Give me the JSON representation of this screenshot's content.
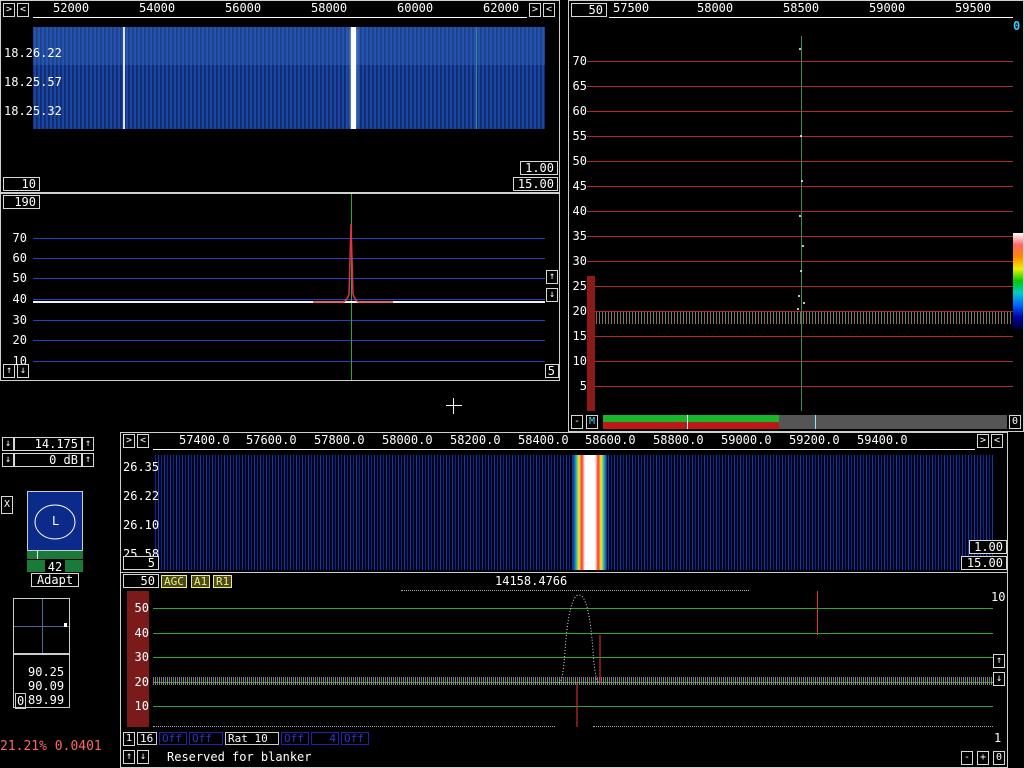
{
  "wide": {
    "freq_ticks": [
      "52000",
      "54000",
      "56000",
      "58000",
      "60000",
      "62000"
    ],
    "time_labels": [
      "18.26.22",
      "18.25.57",
      "18.25.32"
    ],
    "gain_top": "1.00",
    "gain_bottom": "15.00",
    "avg_box": "10",
    "spec_box": "190",
    "spec_y": [
      "70",
      "60",
      "50",
      "40",
      "30",
      "20",
      "10"
    ],
    "spec_right_box": "5"
  },
  "hires": {
    "avg_box": "50",
    "freq_ticks": [
      "57500",
      "58000",
      "58500",
      "59000",
      "59500"
    ],
    "corner_value": "0",
    "y_labels": [
      "70",
      "65",
      "60",
      "55",
      "50",
      "45",
      "40",
      "35",
      "30",
      "25",
      "20",
      "15",
      "10",
      "5"
    ],
    "minus": "-",
    "m": "M",
    "zero": "0"
  },
  "params": {
    "freq": "14.175",
    "gain": "0 dB",
    "x": "X",
    "l": "L",
    "num": "42",
    "adapt": "Adapt",
    "v1": "90.25",
    "v2": "90.09",
    "v3_prefix": "0",
    "v3": "89.99",
    "status": "21.21% 0.0401"
  },
  "baseband": {
    "freq_ticks": [
      "57400.0",
      "57600.0",
      "57800.0",
      "58000.0",
      "58200.0",
      "58400.0",
      "58600.0",
      "58800.0",
      "59000.0",
      "59200.0",
      "59400.0"
    ],
    "time_labels": [
      "26.35",
      "26.22",
      "26.10",
      "25.58"
    ],
    "gain_top": "1.00",
    "gain_bottom": "15.00",
    "left_box": "5",
    "avg_box": "50",
    "agc": "AGC",
    "a1": "A1",
    "r1": "R1",
    "center_freq": "14158.4766",
    "spec_y": [
      "50",
      "40",
      "30",
      "20",
      "10"
    ],
    "right_label": "10",
    "bottom": {
      "b1": "1",
      "b16": "16",
      "off1": "Off",
      "off2": "Off",
      "rat": "Rat 10",
      "off3": "Off",
      "four": "4",
      "off4": "Off",
      "reserved": "Reserved for blanker",
      "right_one": "1",
      "minus": "-",
      "plus": "+",
      "zero": "0"
    }
  },
  "colors": {
    "bluegrid": "#2a3fbf",
    "redgrid": "#b0282a",
    "greengrid": "#2fa53a"
  }
}
